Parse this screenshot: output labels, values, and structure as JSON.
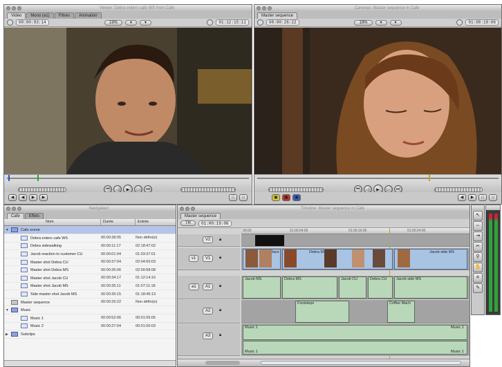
{
  "viewer": {
    "title": "Viewer: Debra enters cafe WS from Cafe",
    "tabs": [
      "Vidéo",
      "Mono (a1)",
      "Filtres",
      "Animation"
    ],
    "timecode_duration": "00:00:03:14",
    "zoom": "19%",
    "view_mode": "",
    "timecode_current": "01:12:15:11"
  },
  "canvas": {
    "title": "Canevas: Master sequence in Cafe",
    "tab": "Master sequence",
    "timecode_duration": "00:00:26:22",
    "zoom": "19%",
    "timecode_current": "01:00:19:06"
  },
  "browser": {
    "title": "Navigateur",
    "tabs": [
      "Cafe",
      "Effets"
    ],
    "columns": [
      "Nom",
      "Durée",
      "Entrée"
    ],
    "rows": [
      {
        "name": "Cafe scene",
        "dur": "",
        "in": "",
        "kind": "bin",
        "indent": 0,
        "open": true,
        "selected": true
      },
      {
        "name": "Debra enters cafe WS",
        "dur": "00:00:38:05",
        "in": "Non défini(e)",
        "kind": "clip",
        "indent": 1
      },
      {
        "name": "Debra sidewalking",
        "dur": "00:00:11:17",
        "in": "02:18:47:02",
        "kind": "clip",
        "indent": 1
      },
      {
        "name": "Jacob reaction to customer CU",
        "dur": "00:00:01:04",
        "in": "01:03:37:01",
        "kind": "clip",
        "indent": 1
      },
      {
        "name": "Master shot Debra CU",
        "dur": "00:00:37:04",
        "in": "02:04:50:03",
        "kind": "clip",
        "indent": 1
      },
      {
        "name": "Master shot Debra MS",
        "dur": "00:00:35:06",
        "in": "02:00:58:08",
        "kind": "clip",
        "indent": 1
      },
      {
        "name": "Master shot Jacob CU",
        "dur": "00:00:34:17",
        "in": "01:12:14:10",
        "kind": "clip",
        "indent": 1
      },
      {
        "name": "Master shot Jacob MS",
        "dur": "00:00:35:11",
        "in": "01:07:11:18",
        "kind": "clip",
        "indent": 1
      },
      {
        "name": "Side master shot Jacob MS",
        "dur": "00:00:35:15",
        "in": "01:18:45:13",
        "kind": "clip",
        "indent": 1
      },
      {
        "name": "Master sequence",
        "dur": "00:00:26:22",
        "in": "Non défini(e)",
        "kind": "seq",
        "indent": 0
      },
      {
        "name": "Music",
        "dur": "",
        "in": "",
        "kind": "bin",
        "indent": 0,
        "open": true
      },
      {
        "name": "Music 1",
        "dur": "00:00:52:06",
        "in": "00:01:55:05",
        "kind": "clip",
        "indent": 1
      },
      {
        "name": "Music 2",
        "dur": "00:00:27:04",
        "in": "00:01:00:03",
        "kind": "clip",
        "indent": 1
      },
      {
        "name": "Subclips",
        "dur": "",
        "in": "",
        "kind": "bin",
        "indent": 0,
        "open": false
      }
    ]
  },
  "timeline": {
    "title": "Timeline: Master sequence in Cafe",
    "tab": "Master sequence",
    "zoom": "TR",
    "timecode": "01:00:19:06",
    "ruler": [
      "00:00",
      "01:00:04:00",
      "01:00:16:00",
      "01:00:24:00"
    ],
    "video_tracks": [
      {
        "patch": "",
        "track": "V2"
      },
      {
        "patch": "v1",
        "track": "V1"
      }
    ],
    "audio_tracks": [
      {
        "patch": "a1",
        "track": "A1"
      },
      {
        "patch": "",
        "track": "A2"
      },
      {
        "patch": "",
        "track": "A3"
      }
    ],
    "v1_clips": [
      "Jaco",
      "Debra MS",
      "Jacob side MS"
    ],
    "a1_clips": [
      "Jacob MS",
      "Debra MS",
      "Jacob CU",
      "Debra CU",
      "Jacob side MS"
    ],
    "a2_clips": [
      "Footsteps",
      "Coffee Mach"
    ],
    "a3_clips": [
      "Music 1",
      "Music 1"
    ],
    "a3_clips_lower": [
      "Music 1",
      "Music 1"
    ]
  },
  "tools": [
    "arrow",
    "select",
    "edit",
    "razor",
    "zoom",
    "hand",
    "crop",
    "pen"
  ],
  "colors": {
    "playhead": "#2b4fbf",
    "video_clip": "#a9c3e3",
    "audio_clip": "#b9d8b9",
    "meter": "#2fa33a"
  }
}
